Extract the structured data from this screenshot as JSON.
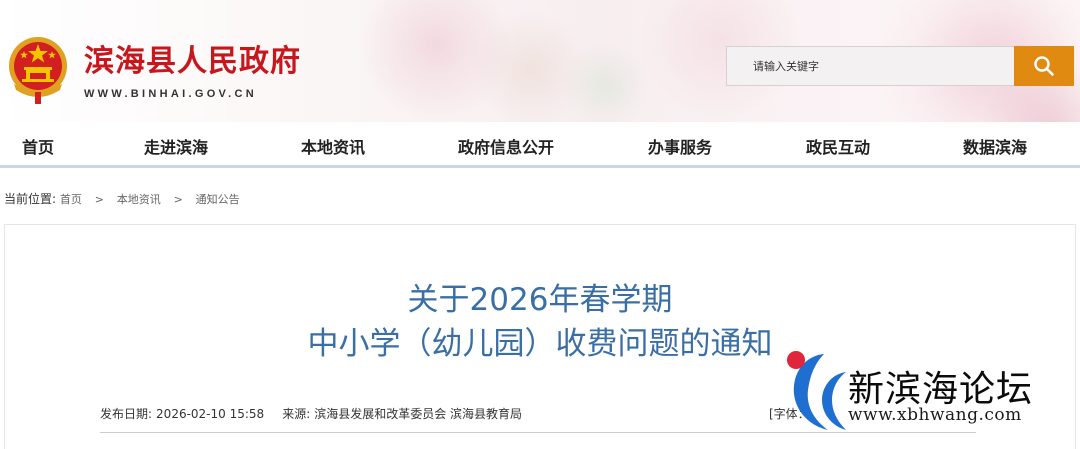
{
  "header": {
    "site_title": "滨海县人民政府",
    "site_url": "WWW.BINHAI.GOV.CN",
    "search_placeholder": "请输入关键字"
  },
  "nav": {
    "items": [
      {
        "label": "首页"
      },
      {
        "label": "走进滨海"
      },
      {
        "label": "本地资讯"
      },
      {
        "label": "政府信息公开"
      },
      {
        "label": "办事服务"
      },
      {
        "label": "政民互动"
      },
      {
        "label": "数据滨海"
      }
    ]
  },
  "breadcrumb": {
    "prefix": "当前位置:",
    "items": [
      "首页",
      "本地资讯",
      "通知公告"
    ],
    "separator": ">"
  },
  "article": {
    "title_line1": "关于2026年春学期",
    "title_line2": "中小学（幼儿园）收费问题的通知",
    "date_label": "发布日期:",
    "date": "2026-02-10 15:58",
    "source_label": "来源:",
    "source": "滨海县发展和改革委员会 滨海县教育局",
    "font_label": "[字体："
  },
  "watermark": {
    "name": "新滨海论坛",
    "url": "www.xbhwang.com"
  },
  "colors": {
    "brand_red": "#c8161d",
    "title_blue": "#3a6fa6",
    "search_orange": "#e08a12",
    "nav_underline": "#c9d7df"
  },
  "icons": {
    "emblem": "national-emblem-icon",
    "search": "search-icon",
    "watermark_logo": "xbh-logo-icon"
  }
}
